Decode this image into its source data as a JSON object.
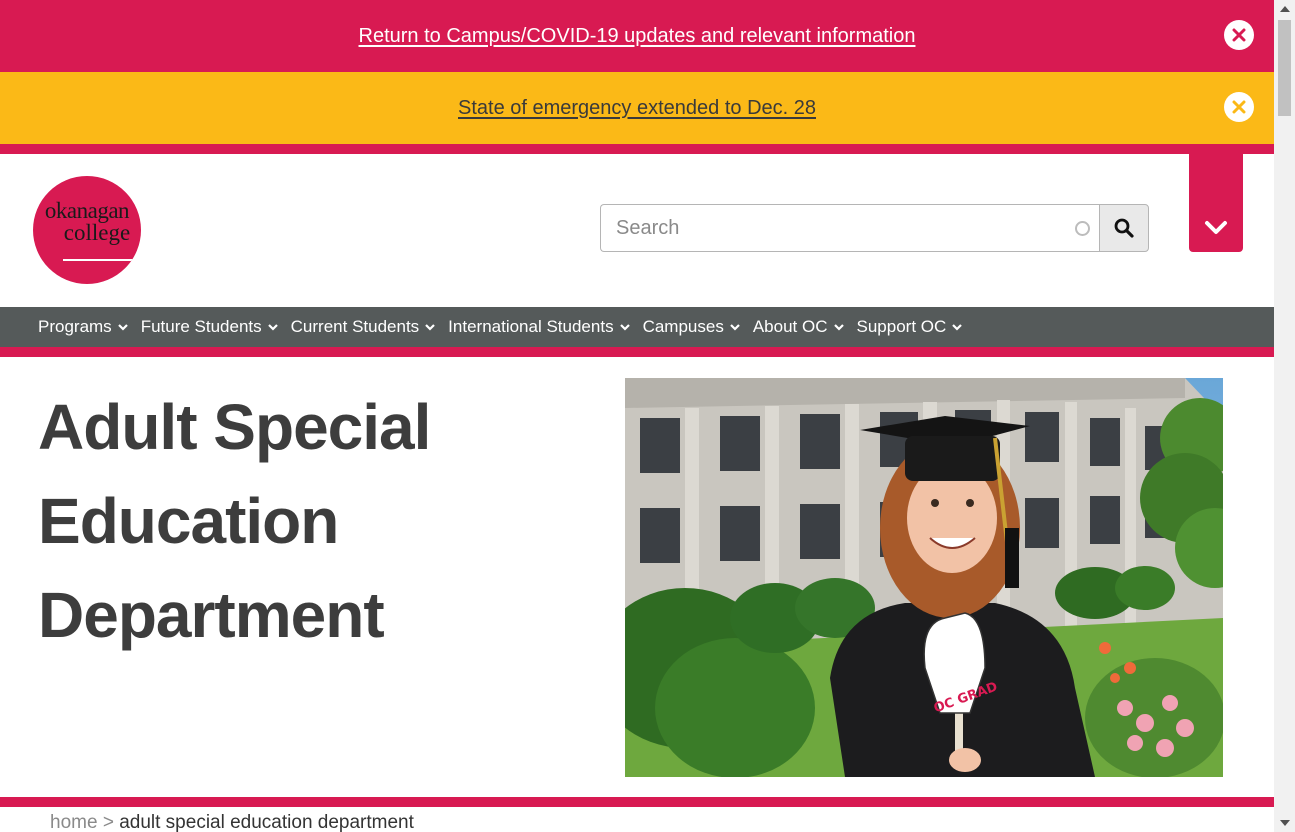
{
  "alerts": {
    "covid": {
      "text": "Return to Campus/COVID-19 updates and relevant information",
      "bg": "#d81a52"
    },
    "emergency": {
      "text": "State of emergency extended to Dec. 28",
      "bg": "#fbb917"
    }
  },
  "logo": {
    "line1": "okanagan",
    "line2": "college"
  },
  "search": {
    "placeholder": "Search",
    "button_icon": "search-icon"
  },
  "menu_toggle_icon": "chevron-down-icon",
  "nav": {
    "items": [
      {
        "label": "Programs"
      },
      {
        "label": "Future Students"
      },
      {
        "label": "Current Students"
      },
      {
        "label": "International Students"
      },
      {
        "label": "Campuses"
      },
      {
        "label": "About OC"
      },
      {
        "label": "Support OC"
      }
    ]
  },
  "hero": {
    "title": "Adult Special Education Department",
    "sign_text": "OC GRAD"
  },
  "breadcrumb": {
    "home": "home",
    "separator": ">",
    "current": "adult special education department"
  },
  "colors": {
    "brand": "#d81a52",
    "warning": "#fbb917",
    "nav": "#555a5a",
    "heading": "#3d3d3d"
  }
}
